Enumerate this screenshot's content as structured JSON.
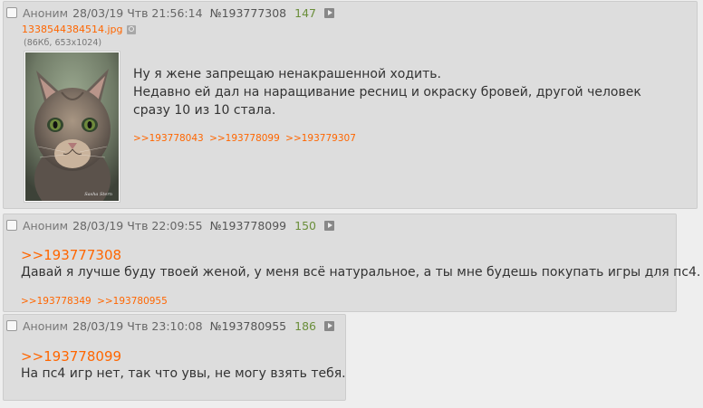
{
  "posts": [
    {
      "author": "Аноним",
      "date": "28/03/19 Чтв 21:56:14",
      "number": "№193777308",
      "count": "147",
      "file": {
        "name": "1338544384514.jpg",
        "meta": "(86Кб, 653x1024)"
      },
      "lines": [
        "Ну я жене запрещаю ненакрашенной ходить.",
        "Недавно ей дал на наращивание ресниц и окраску бровей, другой человек",
        "сразу 10 из 10 стала."
      ],
      "replies": [
        ">>193778043",
        ">>193778099",
        ">>193779307"
      ]
    },
    {
      "author": "Аноним",
      "date": "28/03/19 Чтв 22:09:55",
      "number": "№193778099",
      "count": "150",
      "quote": ">>193777308",
      "lines": [
        "Давай я лучше буду твоей женой, у меня всё натуральное, а ты мне будешь покупать игры для пс4."
      ],
      "replies": [
        ">>193778349",
        ">>193780955"
      ]
    },
    {
      "author": "Аноним",
      "date": "28/03/19 Чтв 23:10:08",
      "number": "№193780955",
      "count": "186",
      "quote": ">>193778099",
      "lines": [
        "На пс4 игр нет, так что увы, не могу взять тебя."
      ]
    }
  ],
  "colors": {
    "accent": "#ff6600",
    "count": "#6a8e3a",
    "post_bg": "#dddddd",
    "page_bg": "#eeeeee"
  },
  "icons": {
    "play": "play-icon",
    "search": "image-search-icon",
    "thumb": "cat-photo"
  }
}
